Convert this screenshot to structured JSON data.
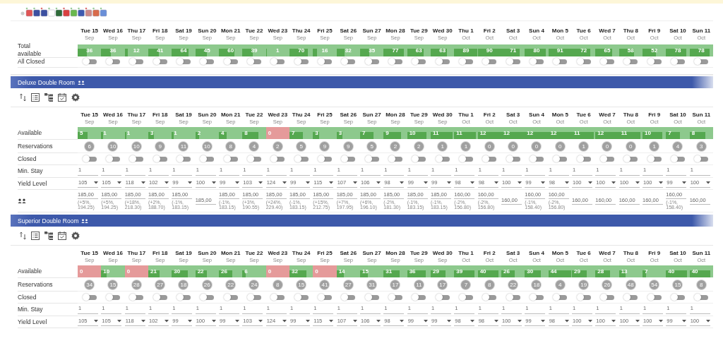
{
  "summary": {
    "dates": [
      {
        "day": "Tue 15",
        "month": "Sep"
      },
      {
        "day": "Wed 16",
        "month": "Sep"
      },
      {
        "day": "Thu 17",
        "month": "Sep"
      },
      {
        "day": "Fri 18",
        "month": "Sep"
      },
      {
        "day": "Sat 19",
        "month": "Sep"
      },
      {
        "day": "Sun 20",
        "month": "Sep"
      },
      {
        "day": "Mon 21",
        "month": "Sep"
      },
      {
        "day": "Tue 22",
        "month": "Sep"
      },
      {
        "day": "Wed 23",
        "month": "Sep"
      },
      {
        "day": "Thu 24",
        "month": "Sep"
      },
      {
        "day": "Fri 25",
        "month": "Sep"
      },
      {
        "day": "Sat 26",
        "month": "Sep"
      },
      {
        "day": "Sun 27",
        "month": "Sep"
      },
      {
        "day": "Mon 28",
        "month": "Sep"
      },
      {
        "day": "Tue 29",
        "month": "Sep"
      },
      {
        "day": "Wed 30",
        "month": "Sep"
      },
      {
        "day": "Thu 1",
        "month": "Oct"
      },
      {
        "day": "Fri 2",
        "month": "Oct"
      },
      {
        "day": "Sat 3",
        "month": "Oct"
      },
      {
        "day": "Sun 4",
        "month": "Oct"
      },
      {
        "day": "Mon 5",
        "month": "Oct"
      },
      {
        "day": "Tue 6",
        "month": "Oct"
      },
      {
        "day": "Wed 7",
        "month": "Oct"
      },
      {
        "day": "Thu 8",
        "month": "Oct"
      },
      {
        "day": "Fri 9",
        "month": "Oct"
      },
      {
        "day": "Sat 10",
        "month": "Oct"
      },
      {
        "day": "Sun 11",
        "month": "Oct"
      }
    ],
    "rows": [
      {
        "kind": "total",
        "label": "Total available",
        "cells": [
          {
            "value": "36",
            "level": 0.4,
            "color": "#8dc98d"
          },
          {
            "value": "36",
            "level": 0.4,
            "color": "#8dc98d"
          },
          {
            "value": "12",
            "level": 0.13,
            "color": "#8dc98d"
          },
          {
            "value": "41",
            "level": 0.45,
            "color": "#8dc98d"
          },
          {
            "value": "64",
            "level": 0.7,
            "color": "#8dc98d"
          },
          {
            "value": "45",
            "level": 0.49,
            "color": "#8dc98d"
          },
          {
            "value": "60",
            "level": 0.66,
            "color": "#8dc98d"
          },
          {
            "value": "39",
            "level": 0.43,
            "color": "#8dc98d"
          },
          {
            "value": "1",
            "level": 0.01,
            "color": "#8dc98d"
          },
          {
            "value": "70",
            "level": 0.77,
            "color": "#8dc98d"
          },
          {
            "value": "16",
            "level": 0.18,
            "color": "#8dc98d"
          },
          {
            "value": "32",
            "level": 0.35,
            "color": "#8dc98d"
          },
          {
            "value": "35",
            "level": 0.38,
            "color": "#8dc98d"
          },
          {
            "value": "77",
            "level": 0.85,
            "color": "#8dc98d"
          },
          {
            "value": "63",
            "level": 0.69,
            "color": "#8dc98d"
          },
          {
            "value": "63",
            "level": 0.69,
            "color": "#8dc98d"
          },
          {
            "value": "89",
            "level": 0.98,
            "color": "#8dc98d"
          },
          {
            "value": "90",
            "level": 0.99,
            "color": "#8dc98d"
          },
          {
            "value": "71",
            "level": 0.78,
            "color": "#8dc98d"
          },
          {
            "value": "80",
            "level": 0.88,
            "color": "#8dc98d"
          },
          {
            "value": "91",
            "level": 1,
            "color": "#8dc98d"
          },
          {
            "value": "72",
            "level": 0.79,
            "color": "#8dc98d"
          },
          {
            "value": "65",
            "level": 0.71,
            "color": "#8dc98d"
          },
          {
            "value": "58",
            "level": 0.64,
            "color": "#8dc98d"
          },
          {
            "value": "52",
            "level": 0.57,
            "color": "#8dc98d"
          },
          {
            "value": "78",
            "level": 0.86,
            "color": "#8dc98d"
          },
          {
            "value": "78",
            "level": 0.86,
            "color": "#8dc98d"
          }
        ]
      },
      {
        "kind": "toggles",
        "label": "All Closed",
        "cells": [
          {
            "on": false
          },
          {
            "on": false
          },
          {
            "on": false
          },
          {
            "on": false
          },
          {
            "on": false
          },
          {
            "on": false
          },
          {
            "on": false
          },
          {
            "on": false
          },
          {
            "on": false
          },
          {
            "on": false
          },
          {
            "on": false
          },
          {
            "on": false
          },
          {
            "on": false
          },
          {
            "on": false
          },
          {
            "on": false
          },
          {
            "on": false
          },
          {
            "on": false
          },
          {
            "on": false
          },
          {
            "on": false
          },
          {
            "on": false
          },
          {
            "on": false
          },
          {
            "on": false
          },
          {
            "on": false
          },
          {
            "on": false
          },
          {
            "on": false
          },
          {
            "on": false
          },
          {
            "on": false
          }
        ]
      }
    ]
  },
  "rooms": [
    {
      "title": "Deluxe Double Room",
      "dates": [
        {
          "day": "Tue 15",
          "month": "Sep"
        },
        {
          "day": "Wed 16",
          "month": "Sep"
        },
        {
          "day": "Thu 17",
          "month": "Sep"
        },
        {
          "day": "Fri 18",
          "month": "Sep"
        },
        {
          "day": "Sat 19",
          "month": "Sep"
        },
        {
          "day": "Sun 20",
          "month": "Sep"
        },
        {
          "day": "Mon 21",
          "month": "Sep"
        },
        {
          "day": "Tue 22",
          "month": "Sep"
        },
        {
          "day": "Wed 23",
          "month": "Sep"
        },
        {
          "day": "Thu 24",
          "month": "Sep"
        },
        {
          "day": "Fri 25",
          "month": "Sep"
        },
        {
          "day": "Sat 26",
          "month": "Sep"
        },
        {
          "day": "Sun 27",
          "month": "Sep"
        },
        {
          "day": "Mon 28",
          "month": "Sep"
        },
        {
          "day": "Tue 29",
          "month": "Sep"
        },
        {
          "day": "Wed 30",
          "month": "Sep"
        },
        {
          "day": "Thu 1",
          "month": "Oct"
        },
        {
          "day": "Fri 2",
          "month": "Oct"
        },
        {
          "day": "Sat 3",
          "month": "Oct"
        },
        {
          "day": "Sun 4",
          "month": "Oct"
        },
        {
          "day": "Mon 5",
          "month": "Oct"
        },
        {
          "day": "Tue 6",
          "month": "Oct"
        },
        {
          "day": "Wed 7",
          "month": "Oct"
        },
        {
          "day": "Thu 8",
          "month": "Oct"
        },
        {
          "day": "Fri 9",
          "month": "Oct"
        },
        {
          "day": "Sat 10",
          "month": "Oct"
        },
        {
          "day": "Sun 11",
          "month": "Oct"
        }
      ],
      "rows": [
        {
          "kind": "availability",
          "label": "Available",
          "cells": [
            {
              "value": "5",
              "level": 0.42,
              "color": "#8dc98d"
            },
            {
              "value": "1",
              "level": 0.08,
              "color": "#8dc98d"
            },
            {
              "value": "1",
              "level": 0.08,
              "color": "#8dc98d"
            },
            {
              "value": "3",
              "level": 0.25,
              "color": "#8dc98d"
            },
            {
              "value": "1",
              "level": 0.08,
              "color": "#8dc98d"
            },
            {
              "value": "2",
              "level": 0.17,
              "color": "#8dc98d"
            },
            {
              "value": "4",
              "level": 0.33,
              "color": "#8dc98d"
            },
            {
              "value": "8",
              "level": 0.67,
              "color": "#8dc98d"
            },
            {
              "value": "0",
              "color": "#e59a9a"
            },
            {
              "value": "7",
              "level": 0.58,
              "color": "#8dc98d"
            },
            {
              "value": "3",
              "level": 0.25,
              "color": "#8dc98d"
            },
            {
              "value": "3",
              "level": 0.25,
              "color": "#8dc98d"
            },
            {
              "value": "7",
              "level": 0.58,
              "color": "#8dc98d"
            },
            {
              "value": "9",
              "level": 0.75,
              "color": "#8dc98d"
            },
            {
              "value": "10",
              "level": 0.83,
              "color": "#8dc98d"
            },
            {
              "value": "11",
              "level": 0.92,
              "color": "#8dc98d"
            },
            {
              "value": "11",
              "level": 0.92,
              "color": "#8dc98d"
            },
            {
              "value": "12",
              "level": 1,
              "color": "#8dc98d"
            },
            {
              "value": "12",
              "level": 1,
              "color": "#8dc98d"
            },
            {
              "value": "12",
              "level": 1,
              "color": "#8dc98d"
            },
            {
              "value": "12",
              "level": 1,
              "color": "#8dc98d"
            },
            {
              "value": "11",
              "level": 0.92,
              "color": "#8dc98d"
            },
            {
              "value": "12",
              "level": 1,
              "color": "#8dc98d"
            },
            {
              "value": "11",
              "level": 0.92,
              "color": "#8dc98d"
            },
            {
              "value": "10",
              "level": 0.83,
              "color": "#8dc98d"
            },
            {
              "value": "7",
              "level": 0.58,
              "color": "#8dc98d"
            },
            {
              "value": "8",
              "level": 0.67,
              "color": "#8dc98d"
            }
          ]
        },
        {
          "kind": "reservations",
          "label": "Reservations",
          "cells": [
            {
              "value": "6"
            },
            {
              "value": "10"
            },
            {
              "value": "10"
            },
            {
              "value": "9"
            },
            {
              "value": "11"
            },
            {
              "value": "10"
            },
            {
              "value": "8"
            },
            {
              "value": "4"
            },
            {
              "value": "2"
            },
            {
              "value": "5"
            },
            {
              "value": "9"
            },
            {
              "value": "9"
            },
            {
              "value": "5"
            },
            {
              "value": "2"
            },
            {
              "value": "2"
            },
            {
              "value": "1"
            },
            {
              "value": "1"
            },
            {
              "value": "0"
            },
            {
              "value": "0"
            },
            {
              "value": "0"
            },
            {
              "value": "0"
            },
            {
              "value": "1"
            },
            {
              "value": "0"
            },
            {
              "value": "0"
            },
            {
              "value": "1"
            },
            {
              "value": "4"
            },
            {
              "value": "3"
            }
          ]
        },
        {
          "kind": "toggles",
          "label": "Closed",
          "cells": [
            {
              "on": false
            },
            {
              "on": false
            },
            {
              "on": false
            },
            {
              "on": false
            },
            {
              "on": false
            },
            {
              "on": false
            },
            {
              "on": false
            },
            {
              "on": false
            },
            {
              "on": false
            },
            {
              "on": false
            },
            {
              "on": false
            },
            {
              "on": false
            },
            {
              "on": false
            },
            {
              "on": false
            },
            {
              "on": false
            },
            {
              "on": false
            },
            {
              "on": false
            },
            {
              "on": false
            },
            {
              "on": false
            },
            {
              "on": false
            },
            {
              "on": false
            },
            {
              "on": false
            },
            {
              "on": false
            },
            {
              "on": false
            },
            {
              "on": false
            },
            {
              "on": false
            },
            {
              "on": false
            }
          ]
        },
        {
          "kind": "min_stay",
          "label": "Min. Stay",
          "cells": [
            {
              "value": "1"
            },
            {
              "value": "1"
            },
            {
              "value": "1"
            },
            {
              "value": "1"
            },
            {
              "value": "1"
            },
            {
              "value": "1"
            },
            {
              "value": "1"
            },
            {
              "value": "1"
            },
            {
              "value": "1"
            },
            {
              "value": "1"
            },
            {
              "value": "1"
            },
            {
              "value": "1"
            },
            {
              "value": "1"
            },
            {
              "value": "1"
            },
            {
              "value": "1"
            },
            {
              "value": "1"
            },
            {
              "value": "1"
            },
            {
              "value": "1"
            },
            {
              "value": "1"
            },
            {
              "value": "1"
            },
            {
              "value": "1"
            },
            {
              "value": "1"
            },
            {
              "value": "1"
            },
            {
              "value": "1"
            },
            {
              "value": "1"
            },
            {
              "value": "1"
            },
            {
              "value": "1"
            }
          ]
        },
        {
          "kind": "yield",
          "label": "Yield Level",
          "cells": [
            {
              "value": "105"
            },
            {
              "value": "105"
            },
            {
              "value": "118"
            },
            {
              "value": "102"
            },
            {
              "value": "99"
            },
            {
              "value": "100"
            },
            {
              "value": "99"
            },
            {
              "value": "103"
            },
            {
              "value": "124"
            },
            {
              "value": "99"
            },
            {
              "value": "115"
            },
            {
              "value": "107"
            },
            {
              "value": "106"
            },
            {
              "value": "98"
            },
            {
              "value": "99"
            },
            {
              "value": "99"
            },
            {
              "value": "98"
            },
            {
              "value": "98"
            },
            {
              "value": "100"
            },
            {
              "value": "99"
            },
            {
              "value": "98"
            },
            {
              "value": "100"
            },
            {
              "value": "100"
            },
            {
              "value": "100"
            },
            {
              "value": "100"
            },
            {
              "value": "99"
            },
            {
              "value": "100"
            }
          ]
        },
        {
          "kind": "price",
          "cells": [
            {
              "price": "185,00",
              "change": "(+5%, 194.25)"
            },
            {
              "price": "185,00",
              "change": "(+5%, 194.25)"
            },
            {
              "price": "185,00",
              "change": "(+18%, 218.30)"
            },
            {
              "price": "185,00",
              "change": "(+2%, 188.70)"
            },
            {
              "price": "185,00",
              "change": "(-1%, 183.15)"
            },
            {
              "price": "185,00"
            },
            {
              "price": "185,00",
              "change": "(-1%, 183.15)"
            },
            {
              "price": "185,00",
              "change": "(+3%, 190.55)"
            },
            {
              "price": "185,00",
              "change": "(+24%, 229.40)"
            },
            {
              "price": "185,00",
              "change": "(-1%, 183.15)"
            },
            {
              "price": "185,00",
              "change": "(+15%, 212.75)"
            },
            {
              "price": "185,00",
              "change": "(+7%, 197.95)"
            },
            {
              "price": "185,00",
              "change": "(+6%, 196.10)"
            },
            {
              "price": "185,00",
              "change": "(-2%, 181.30)"
            },
            {
              "price": "185,00",
              "change": "(-1%, 183.15)"
            },
            {
              "price": "185,00",
              "change": "(-1%, 183.15)"
            },
            {
              "price": "160,00",
              "change": "(-2%, 156.80)"
            },
            {
              "price": "160,00",
              "change": "(-2%, 156.80)"
            },
            {
              "price": "160,00"
            },
            {
              "price": "160,00",
              "change": "(-1%, 158.40)"
            },
            {
              "price": "160,00",
              "change": "(-2%, 156.80)"
            },
            {
              "price": "160,00"
            },
            {
              "price": "160,00"
            },
            {
              "price": "160,00"
            },
            {
              "price": "160,00"
            },
            {
              "price": "160,00",
              "change": "(-1%, 158.40)"
            },
            {
              "price": "160,00"
            }
          ]
        }
      ]
    },
    {
      "title": "Superior Double Room",
      "dates": [
        {
          "day": "Tue 15",
          "month": "Sep"
        },
        {
          "day": "Wed 16",
          "month": "Sep"
        },
        {
          "day": "Thu 17",
          "month": "Sep"
        },
        {
          "day": "Fri 18",
          "month": "Sep"
        },
        {
          "day": "Sat 19",
          "month": "Sep"
        },
        {
          "day": "Sun 20",
          "month": "Sep"
        },
        {
          "day": "Mon 21",
          "month": "Sep"
        },
        {
          "day": "Tue 22",
          "month": "Sep"
        },
        {
          "day": "Wed 23",
          "month": "Sep"
        },
        {
          "day": "Thu 24",
          "month": "Sep"
        },
        {
          "day": "Fri 25",
          "month": "Sep"
        },
        {
          "day": "Sat 26",
          "month": "Sep"
        },
        {
          "day": "Sun 27",
          "month": "Sep"
        },
        {
          "day": "Mon 28",
          "month": "Sep"
        },
        {
          "day": "Tue 29",
          "month": "Sep"
        },
        {
          "day": "Wed 30",
          "month": "Sep"
        },
        {
          "day": "Thu 1",
          "month": "Oct"
        },
        {
          "day": "Fri 2",
          "month": "Oct"
        },
        {
          "day": "Sat 3",
          "month": "Oct"
        },
        {
          "day": "Sun 4",
          "month": "Oct"
        },
        {
          "day": "Mon 5",
          "month": "Oct"
        },
        {
          "day": "Tue 6",
          "month": "Oct"
        },
        {
          "day": "Wed 7",
          "month": "Oct"
        },
        {
          "day": "Thu 8",
          "month": "Oct"
        },
        {
          "day": "Fri 9",
          "month": "Oct"
        },
        {
          "day": "Sat 10",
          "month": "Oct"
        },
        {
          "day": "Sun 11",
          "month": "Oct"
        }
      ],
      "rows": [
        {
          "kind": "availability",
          "label": "Available",
          "cells": [
            {
              "value": "0",
              "color": "#e59a9a"
            },
            {
              "value": "10",
              "level": 0.22,
              "color": "#8dc98d"
            },
            {
              "value": "0",
              "color": "#e59a9a"
            },
            {
              "value": "21",
              "level": 0.47,
              "color": "#8dc98d"
            },
            {
              "value": "30",
              "level": 0.67,
              "color": "#8dc98d"
            },
            {
              "value": "22",
              "level": 0.49,
              "color": "#8dc98d"
            },
            {
              "value": "26",
              "level": 0.58,
              "color": "#8dc98d"
            },
            {
              "value": "6",
              "level": 0.13,
              "color": "#8dc98d"
            },
            {
              "value": "0",
              "color": "#e59a9a"
            },
            {
              "value": "32",
              "level": 0.71,
              "color": "#8dc98d"
            },
            {
              "value": "0",
              "color": "#e59a9a"
            },
            {
              "value": "14",
              "level": 0.31,
              "color": "#8dc98d"
            },
            {
              "value": "15",
              "level": 0.33,
              "color": "#8dc98d"
            },
            {
              "value": "31",
              "level": 0.69,
              "color": "#8dc98d"
            },
            {
              "value": "36",
              "level": 0.8,
              "color": "#8dc98d"
            },
            {
              "value": "29",
              "level": 0.64,
              "color": "#8dc98d"
            },
            {
              "value": "39",
              "level": 0.87,
              "color": "#8dc98d"
            },
            {
              "value": "40",
              "level": 0.89,
              "color": "#8dc98d"
            },
            {
              "value": "26",
              "level": 0.58,
              "color": "#8dc98d"
            },
            {
              "value": "30",
              "level": 0.67,
              "color": "#8dc98d"
            },
            {
              "value": "44",
              "level": 0.98,
              "color": "#8dc98d"
            },
            {
              "value": "29",
              "level": 0.64,
              "color": "#8dc98d"
            },
            {
              "value": "28",
              "level": 0.62,
              "color": "#8dc98d"
            },
            {
              "value": "13",
              "level": 0.29,
              "color": "#8dc98d"
            },
            {
              "value": "7",
              "level": 0.16,
              "color": "#8dc98d"
            },
            {
              "value": "40",
              "level": 0.89,
              "color": "#8dc98d"
            },
            {
              "value": "40",
              "level": 0.89,
              "color": "#8dc98d"
            }
          ]
        },
        {
          "kind": "reservations",
          "label": "Reservations",
          "cells": [
            {
              "value": "34"
            },
            {
              "value": "15"
            },
            {
              "value": "28"
            },
            {
              "value": "27"
            },
            {
              "value": "18"
            },
            {
              "value": "26"
            },
            {
              "value": "22"
            },
            {
              "value": "24"
            },
            {
              "value": "8"
            },
            {
              "value": "15"
            },
            {
              "value": "41"
            },
            {
              "value": "27"
            },
            {
              "value": "31"
            },
            {
              "value": "17"
            },
            {
              "value": "11"
            },
            {
              "value": "17"
            },
            {
              "value": "7"
            },
            {
              "value": "8"
            },
            {
              "value": "22"
            },
            {
              "value": "18"
            },
            {
              "value": "4"
            },
            {
              "value": "19"
            },
            {
              "value": "26"
            },
            {
              "value": "48"
            },
            {
              "value": "54"
            },
            {
              "value": "15"
            },
            {
              "value": "8"
            }
          ]
        },
        {
          "kind": "toggles",
          "label": "Closed",
          "cells": [
            {
              "on": false
            },
            {
              "on": false
            },
            {
              "on": false
            },
            {
              "on": false
            },
            {
              "on": false
            },
            {
              "on": false
            },
            {
              "on": false
            },
            {
              "on": false
            },
            {
              "on": false
            },
            {
              "on": false
            },
            {
              "on": false
            },
            {
              "on": false
            },
            {
              "on": false
            },
            {
              "on": false
            },
            {
              "on": false
            },
            {
              "on": false
            },
            {
              "on": false
            },
            {
              "on": false
            },
            {
              "on": false
            },
            {
              "on": false
            },
            {
              "on": false
            },
            {
              "on": false
            },
            {
              "on": false
            },
            {
              "on": false
            },
            {
              "on": false
            },
            {
              "on": false
            },
            {
              "on": false
            }
          ]
        },
        {
          "kind": "min_stay",
          "label": "Min. Stay",
          "cells": [
            {
              "value": "1"
            },
            {
              "value": "1"
            },
            {
              "value": "1"
            },
            {
              "value": "1"
            },
            {
              "value": "1"
            },
            {
              "value": "1"
            },
            {
              "value": "1"
            },
            {
              "value": "1"
            },
            {
              "value": "1"
            },
            {
              "value": "1"
            },
            {
              "value": "1"
            },
            {
              "value": "1"
            },
            {
              "value": "1"
            },
            {
              "value": "1"
            },
            {
              "value": "1"
            },
            {
              "value": "1"
            },
            {
              "value": "1"
            },
            {
              "value": "1"
            },
            {
              "value": "1"
            },
            {
              "value": "1"
            },
            {
              "value": "1"
            },
            {
              "value": "1"
            },
            {
              "value": "1"
            },
            {
              "value": "1"
            },
            {
              "value": "1"
            },
            {
              "value": "1"
            },
            {
              "value": "1"
            }
          ]
        },
        {
          "kind": "yield",
          "label": "Yield Level",
          "cells": [
            {
              "value": "105"
            },
            {
              "value": "105"
            },
            {
              "value": "118"
            },
            {
              "value": "102"
            },
            {
              "value": "99"
            },
            {
              "value": "100"
            },
            {
              "value": "99"
            },
            {
              "value": "103"
            },
            {
              "value": "124"
            },
            {
              "value": "99"
            },
            {
              "value": "115"
            },
            {
              "value": "107"
            },
            {
              "value": "106"
            },
            {
              "value": "98"
            },
            {
              "value": "99"
            },
            {
              "value": "99"
            },
            {
              "value": "98"
            },
            {
              "value": "98"
            },
            {
              "value": "100"
            },
            {
              "value": "99"
            },
            {
              "value": "98"
            },
            {
              "value": "100"
            },
            {
              "value": "100"
            },
            {
              "value": "100"
            },
            {
              "value": "100"
            },
            {
              "value": "99"
            },
            {
              "value": "100"
            }
          ]
        }
      ]
    }
  ]
}
